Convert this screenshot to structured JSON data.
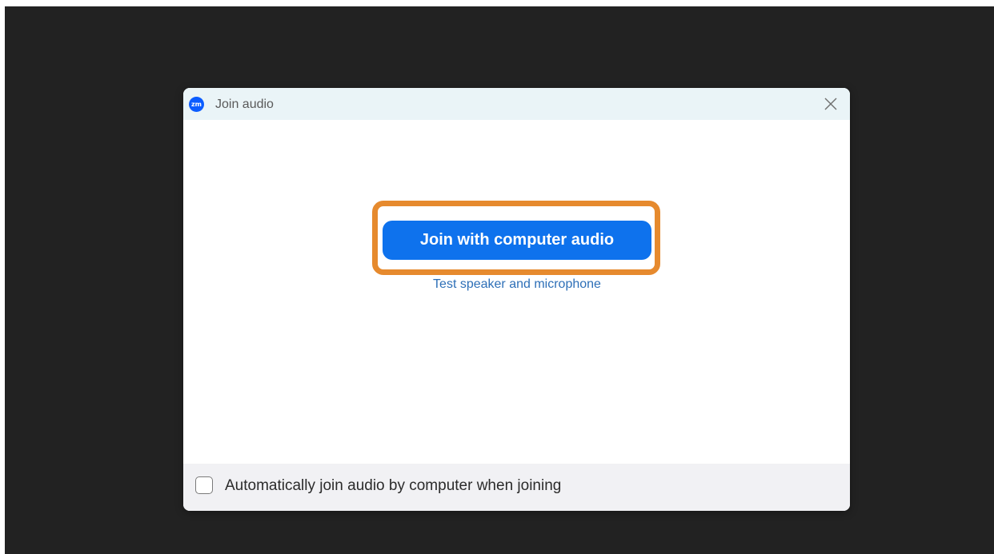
{
  "dialog": {
    "title": "Join audio",
    "logo_text": "zm",
    "close_icon": "close-icon"
  },
  "main": {
    "join_button_label": "Join with computer audio",
    "test_link_label": "Test speaker and microphone"
  },
  "footer": {
    "auto_join_label": "Automatically join audio by computer when joining",
    "auto_join_checked": false
  },
  "colors": {
    "primary_button": "#0e72ed",
    "highlight_outline": "#e68a2e",
    "link": "#2d6fb7",
    "titlebar": "#eaf4f7",
    "backdrop": "#222222"
  }
}
